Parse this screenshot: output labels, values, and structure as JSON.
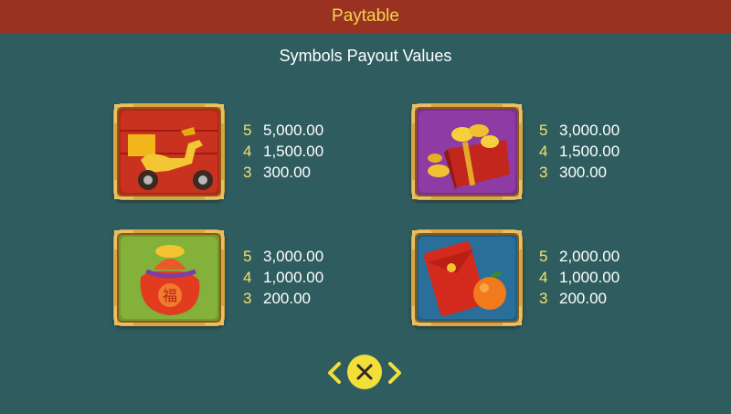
{
  "header": {
    "title": "Paytable"
  },
  "subtitle": "Symbols Payout Values",
  "symbols": [
    {
      "icon": "scooter-icon",
      "pays": [
        {
          "count": "5",
          "amount": "5,000.00"
        },
        {
          "count": "4",
          "amount": "1,500.00"
        },
        {
          "count": "3",
          "amount": "300.00"
        }
      ]
    },
    {
      "icon": "treasure-chest-icon",
      "pays": [
        {
          "count": "5",
          "amount": "3,000.00"
        },
        {
          "count": "4",
          "amount": "1,500.00"
        },
        {
          "count": "3",
          "amount": "300.00"
        }
      ]
    },
    {
      "icon": "lucky-bag-icon",
      "pays": [
        {
          "count": "5",
          "amount": "3,000.00"
        },
        {
          "count": "4",
          "amount": "1,000.00"
        },
        {
          "count": "3",
          "amount": "200.00"
        }
      ]
    },
    {
      "icon": "red-envelope-orange-icon",
      "pays": [
        {
          "count": "5",
          "amount": "2,000.00"
        },
        {
          "count": "4",
          "amount": "1,000.00"
        },
        {
          "count": "3",
          "amount": "200.00"
        }
      ]
    }
  ],
  "controls": {
    "prev_icon": "chevron-left-icon",
    "close_icon": "close-icon",
    "next_icon": "chevron-right-icon"
  },
  "colors": {
    "background": "#2f5d5f",
    "header": "#9a3221",
    "accent": "#f6d34f",
    "count": "#f5e06a"
  }
}
